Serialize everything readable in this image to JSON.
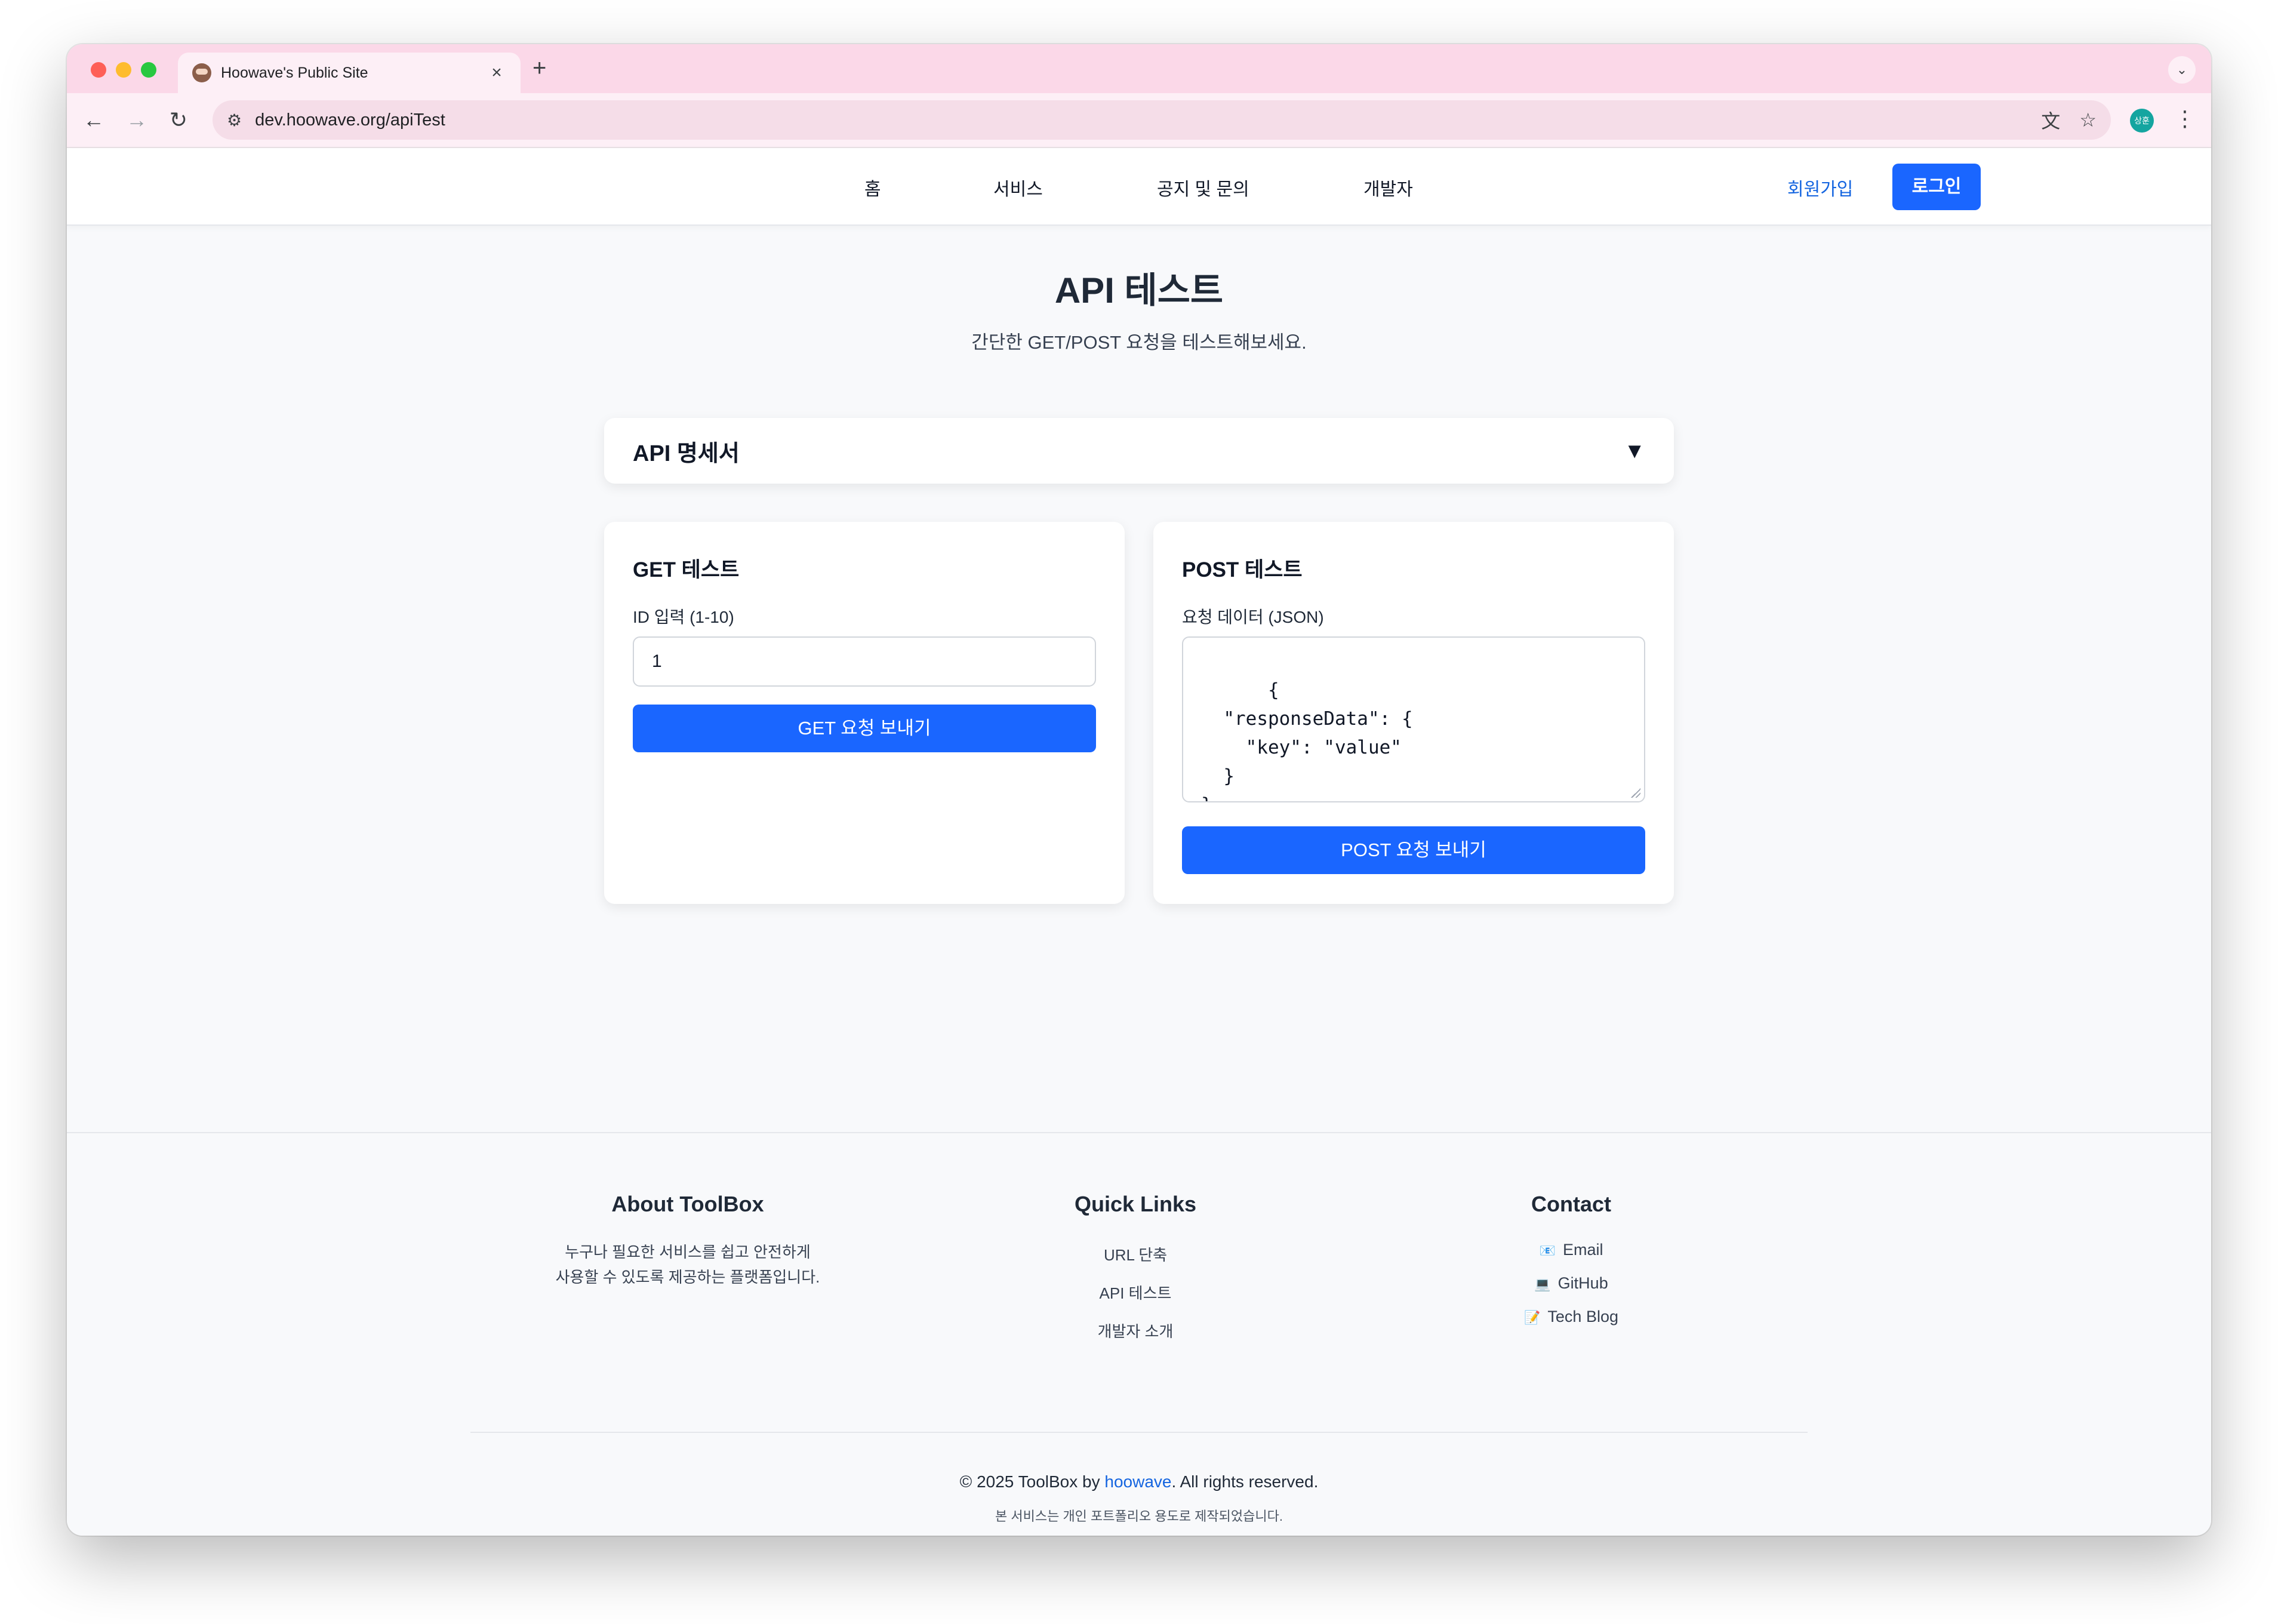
{
  "browser": {
    "tab_title": "Hoowave's Public Site",
    "tab_close": "×",
    "new_tab": "+",
    "tab_menu": "⌄",
    "url": "dev.hoowave.org/apiTest",
    "profile_initials": "상훈",
    "icons": [
      "back-icon",
      "forward-icon",
      "reload-icon",
      "site-info-icon",
      "translate-icon",
      "bookmark-star-icon",
      "more-icon"
    ]
  },
  "nav": {
    "home": "홈",
    "services": "서비스",
    "notice": "공지 및 문의",
    "developer": "개발자",
    "signup": "회원가입",
    "login": "로그인"
  },
  "main": {
    "title": "API 테스트",
    "subtitle": "간단한 GET/POST 요청을 테스트해보세요.",
    "accordion_title": "API 명세서",
    "accordion_arrow": "▼",
    "get_card": {
      "title": "GET 테스트",
      "label": "ID 입력 (1-10)",
      "value": "1",
      "button": "GET 요청 보내기"
    },
    "post_card": {
      "title": "POST 테스트",
      "label": "요청 데이터 (JSON)",
      "json": "{\n  \"responseData\": {\n    \"key\": \"value\"\n  }\n}",
      "button": "POST 요청 보내기"
    }
  },
  "footer": {
    "about_heading": "About ToolBox",
    "about_line1": "누구나 필요한 서비스를 쉽고 안전하게",
    "about_line2": "사용할 수 있도록 제공하는 플랫폼입니다.",
    "links_heading": "Quick Links",
    "links": [
      "URL 단축",
      "API 테스트",
      "개발자 소개"
    ],
    "contact_heading": "Contact",
    "contacts": [
      {
        "icon": "📧",
        "label": "Email"
      },
      {
        "icon": "💻",
        "label": "GitHub"
      },
      {
        "icon": "📝",
        "label": "Tech Blog"
      }
    ],
    "copyright_prefix": "© 2025 ToolBox by ",
    "copyright_link": "hoowave",
    "copyright_suffix": ". All rights reserved.",
    "note": "본 서비스는 개인 포트폴리오 용도로 제작되었습니다."
  },
  "colors": {
    "accent": "#1a66ff",
    "link": "#1565e0",
    "tabstrip": "#fbd8e8"
  }
}
